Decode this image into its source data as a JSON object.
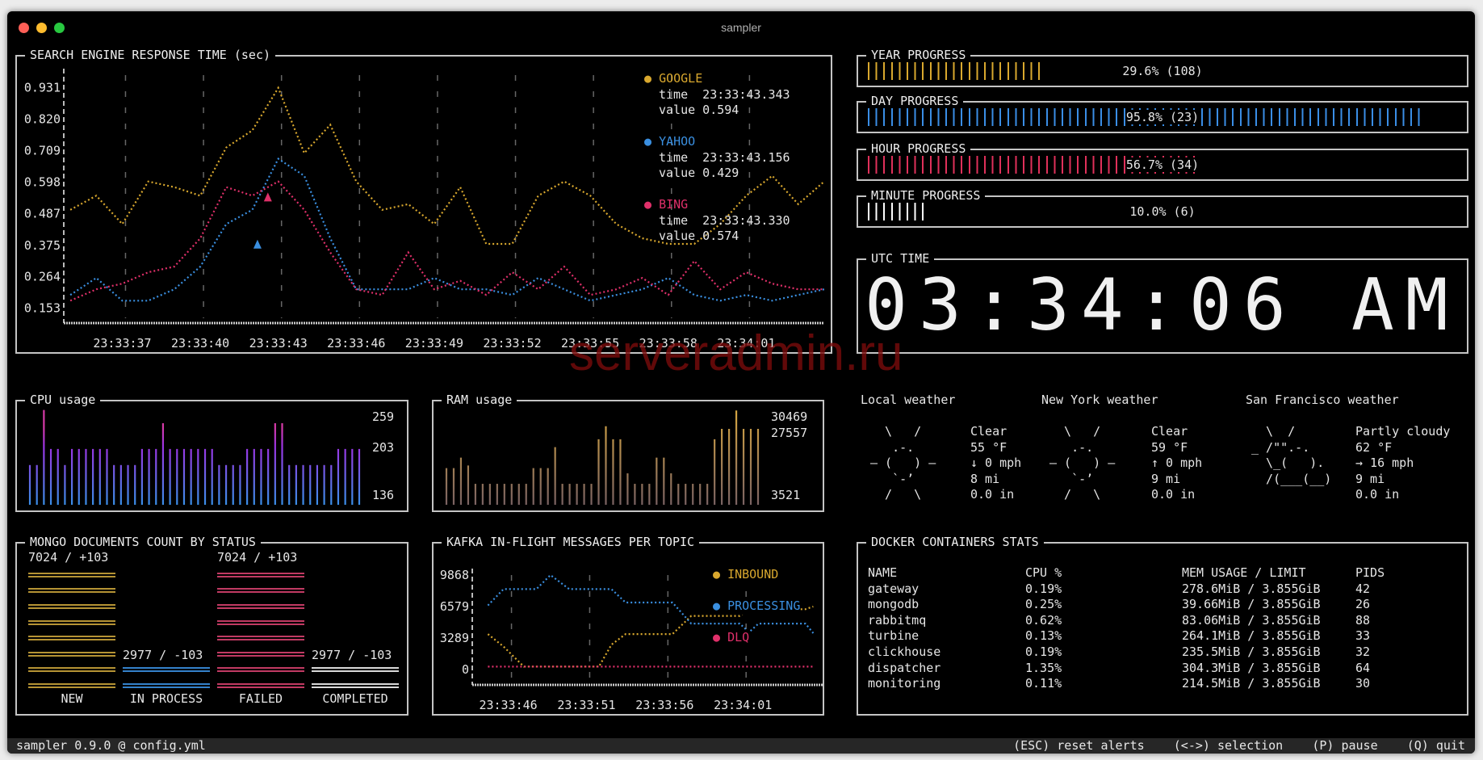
{
  "window": {
    "title": "sampler",
    "controls": {
      "close": "#fe5f57",
      "minimize": "#febc2e",
      "zoom": "#28c840"
    }
  },
  "watermark": "serveradmin.ru",
  "search": {
    "title": "SEARCH ENGINE RESPONSE TIME (sec)",
    "legend": [
      {
        "name": "GOOGLE",
        "time_label": "time  23:33:43.343",
        "value_label": "value 0.594"
      },
      {
        "name": "YAHOO",
        "time_label": "time  23:33:43.156",
        "value_label": "value 0.429"
      },
      {
        "name": "BING",
        "time_label": "time  23:33:43.330",
        "value_label": "value 0.574"
      }
    ]
  },
  "chart_data": [
    {
      "type": "line",
      "title": "SEARCH ENGINE RESPONSE TIME (sec)",
      "xlim": [
        "23:33:34.75",
        "23:34:04"
      ],
      "ylim": [
        0.101,
        0.975
      ],
      "yticks": [
        "0.931",
        "0.820",
        "0.709",
        "0.598",
        "0.487",
        "0.375",
        "0.264",
        "0.153"
      ],
      "xticks": [
        "23:33:37",
        "23:33:40",
        "23:33:43",
        "23:33:46",
        "23:33:49",
        "23:33:52",
        "23:33:55",
        "23:33:58",
        "23:34:01"
      ],
      "grid": "vertical dashed",
      "legend": "top-right",
      "x": [
        "23:33:35",
        "23:33:36",
        "23:33:37",
        "23:33:38",
        "23:33:39",
        "23:33:40",
        "23:33:41",
        "23:33:42",
        "23:33:43",
        "23:33:44",
        "23:33:45",
        "23:33:46",
        "23:33:47",
        "23:33:48",
        "23:33:49",
        "23:33:50",
        "23:33:51",
        "23:33:52",
        "23:33:53",
        "23:33:54",
        "23:33:55",
        "23:33:56",
        "23:33:57",
        "23:33:58",
        "23:33:59",
        "23:34:00",
        "23:34:01",
        "23:34:02",
        "23:34:03",
        "23:34:04"
      ],
      "series": [
        {
          "name": "GOOGLE",
          "color": "#d9a82e",
          "values": [
            0.5,
            0.55,
            0.45,
            0.6,
            0.58,
            0.55,
            0.72,
            0.78,
            0.93,
            0.7,
            0.8,
            0.6,
            0.5,
            0.52,
            0.45,
            0.58,
            0.38,
            0.38,
            0.55,
            0.6,
            0.55,
            0.45,
            0.4,
            0.38,
            0.38,
            0.45,
            0.55,
            0.62,
            0.52,
            0.6
          ]
        },
        {
          "name": "YAHOO",
          "color": "#3a8fe0",
          "values": [
            0.2,
            0.26,
            0.18,
            0.18,
            0.22,
            0.3,
            0.45,
            0.5,
            0.68,
            0.62,
            0.4,
            0.22,
            0.22,
            0.22,
            0.26,
            0.22,
            0.22,
            0.2,
            0.26,
            0.22,
            0.18,
            0.2,
            0.22,
            0.26,
            0.2,
            0.18,
            0.2,
            0.18,
            0.2,
            0.22
          ]
        },
        {
          "name": "BING",
          "color": "#e0306a",
          "values": [
            0.18,
            0.22,
            0.24,
            0.28,
            0.3,
            0.4,
            0.58,
            0.55,
            0.6,
            0.5,
            0.35,
            0.22,
            0.2,
            0.35,
            0.22,
            0.25,
            0.2,
            0.28,
            0.22,
            0.3,
            0.2,
            0.22,
            0.26,
            0.2,
            0.32,
            0.22,
            0.28,
            0.24,
            0.22,
            0.22
          ]
        }
      ],
      "markers": [
        {
          "series": "BING",
          "x": "23:33:42.6",
          "y": 0.544
        },
        {
          "series": "YAHOO",
          "x": "23:33:42.2",
          "y": 0.378
        }
      ]
    },
    {
      "type": "bar",
      "title": "CPU usage",
      "ylim": [
        123,
        262
      ],
      "labels": [
        "259",
        "203",
        "136"
      ],
      "values": [
        180,
        180,
        259,
        203,
        203,
        180,
        203,
        203,
        203,
        203,
        203,
        203,
        180,
        180,
        180,
        180,
        203,
        203,
        203,
        240,
        203,
        203,
        203,
        203,
        203,
        203,
        203,
        180,
        180,
        180,
        180,
        203,
        203,
        203,
        203,
        240,
        240,
        180,
        180,
        180,
        180,
        180,
        180,
        180,
        203,
        203,
        203,
        203
      ],
      "colors": [
        "#3a8fe8",
        "#9b34e6",
        "#d63aa8"
      ]
    },
    {
      "type": "bar",
      "title": "RAM usage",
      "ylim": [
        0,
        37000
      ],
      "labels": [
        "30469",
        "27557",
        "3521"
      ],
      "values": [
        14000,
        14000,
        18000,
        15000,
        8000,
        8000,
        8000,
        8000,
        8000,
        8000,
        8000,
        8000,
        14000,
        14000,
        14000,
        22000,
        8000,
        8000,
        8000,
        8000,
        8000,
        25000,
        30000,
        25000,
        25000,
        12000,
        8000,
        8000,
        8000,
        18000,
        18000,
        12000,
        8000,
        8000,
        8000,
        8000,
        8000,
        25000,
        29000,
        29000,
        36000,
        29000,
        29000,
        29000
      ],
      "colors": [
        "#7a6262",
        "#d9a840"
      ]
    },
    {
      "type": "line",
      "title": "KAFKA IN-FLIGHT MESSAGES PER TOPIC",
      "xlim": [
        "23:33:43.7",
        "23:34:06.1"
      ],
      "ylim": [
        0,
        9868
      ],
      "yticks": [
        "9868",
        "6579",
        "3289",
        "0"
      ],
      "xticks": [
        "23:33:46",
        "23:33:51",
        "23:33:56",
        "23:34:01"
      ],
      "legend": "right",
      "series": [
        {
          "name": "INBOUND",
          "color": "#d9a82e",
          "points": [
            [
              "23:33:44.7",
              3700
            ],
            [
              "23:33:45.7",
              2400
            ],
            [
              "23:33:47",
              300
            ],
            [
              "23:33:51.8",
              300
            ],
            [
              "23:33:52.6",
              2600
            ],
            [
              "23:33:53.5",
              3700
            ],
            [
              "23:33:56.5",
              3700
            ],
            [
              "23:33:57.7",
              5600
            ],
            [
              "23:34:00.8",
              5600
            ],
            [
              "23:34:01.4",
              6300
            ],
            [
              "23:34:05",
              6300
            ],
            [
              "23:34:05.5",
              6579
            ]
          ]
        },
        {
          "name": "PROCESSING",
          "color": "#3a8fe0",
          "points": [
            [
              "23:33:44.7",
              6700
            ],
            [
              "23:33:45.7",
              8400
            ],
            [
              "23:33:47.8",
              8400
            ],
            [
              "23:33:48.7",
              9868
            ],
            [
              "23:33:49.9",
              8400
            ],
            [
              "23:33:52.6",
              8400
            ],
            [
              "23:33:53.5",
              7000
            ],
            [
              "23:33:56.5",
              7000
            ],
            [
              "23:33:57.7",
              4800
            ],
            [
              "23:34:00.8",
              4800
            ],
            [
              "23:34:01.4",
              3900
            ],
            [
              "23:34:02",
              4800
            ],
            [
              "23:34:05",
              4800
            ],
            [
              "23:34:05.5",
              3800
            ]
          ]
        },
        {
          "name": "DLQ",
          "color": "#e0306a",
          "points": [
            [
              "23:33:44.7",
              300
            ],
            [
              "23:34:05.5",
              300
            ]
          ]
        }
      ]
    }
  ],
  "progress": [
    {
      "title": "YEAR PROGRESS",
      "percent": 29.6,
      "label": "29.6% (108)",
      "color": "#d9a82e"
    },
    {
      "title": "DAY PROGRESS",
      "percent": 95.8,
      "label": "95.8% (23)",
      "color": "#3a8ee6"
    },
    {
      "title": "HOUR PROGRESS",
      "percent": 56.7,
      "label": "56.7% (34)",
      "color": "#e0305a"
    },
    {
      "title": "MINUTE PROGRESS",
      "percent": 10.0,
      "label": "10.0% (6)",
      "color": "#ffffff"
    }
  ],
  "utc": {
    "title": "UTC TIME",
    "time": "03:34:06 AM"
  },
  "weather": [
    {
      "title": "Local weather",
      "art": "  \\   /  \n   .-.   \n― (   ) ―\n   `-’   \n  /   \\  ",
      "lines": [
        "Clear",
        "55 °F",
        "↓ 0 mph",
        "8 mi",
        "0.0 in"
      ]
    },
    {
      "title": "New York weather",
      "art": "  \\   /  \n   .-.   \n― (   ) ―\n   `-’   \n  /   \\  ",
      "lines": [
        "Clear",
        "59 °F",
        "↑ 0 mph",
        "9 mi",
        "0.0 in"
      ]
    },
    {
      "title": "San Francisco weather",
      "art": "  \\  /   \n_ /\"\".-. \n  \\_(   ).\n  /(___(__)\n          ",
      "lines": [
        "Partly cloudy",
        "62 °F",
        "→ 16 mph",
        "9 mi",
        "0.0 in"
      ]
    }
  ],
  "mongo": {
    "title": "MONGO DOCUMENTS COUNT BY STATUS",
    "columns": [
      {
        "name": "NEW",
        "value": 7024,
        "label": "7024 / +103",
        "color": "#c9a43a",
        "rows": 8
      },
      {
        "name": "IN PROCESS",
        "value": 2977,
        "label": "2977 / -103",
        "color": "#3a8fe0",
        "rows": 2
      },
      {
        "name": "FAILED",
        "value": 7024,
        "label": "7024 / +103",
        "color": "#d6416e",
        "rows": 8
      },
      {
        "name": "COMPLETED",
        "value": 2977,
        "label": "2977 / -103",
        "color": "#f0f0f0",
        "rows": 2
      }
    ]
  },
  "docker": {
    "title": "DOCKER CONTAINERS STATS",
    "headers": [
      "NAME",
      "CPU %",
      "MEM USAGE / LIMIT",
      "PIDS"
    ],
    "rows": [
      [
        "gateway",
        "0.19%",
        "278.6MiB / 3.855GiB",
        "42"
      ],
      [
        "mongodb",
        "0.25%",
        "39.66MiB / 3.855GiB",
        "26"
      ],
      [
        "rabbitmq",
        "0.62%",
        "83.06MiB / 3.855GiB",
        "88"
      ],
      [
        "turbine",
        "0.13%",
        "264.1MiB / 3.855GiB",
        "33"
      ],
      [
        "clickhouse",
        "0.19%",
        "235.5MiB / 3.855GiB",
        "32"
      ],
      [
        "dispatcher",
        "1.35%",
        "304.3MiB / 3.855GiB",
        "64"
      ],
      [
        "monitoring",
        "0.11%",
        "214.5MiB / 3.855GiB",
        "30"
      ]
    ]
  },
  "status": {
    "left": "sampler 0.9.0 @ config.yml",
    "right": "(ESC) reset alerts    (<->) selection    (P) pause    (Q) quit"
  }
}
